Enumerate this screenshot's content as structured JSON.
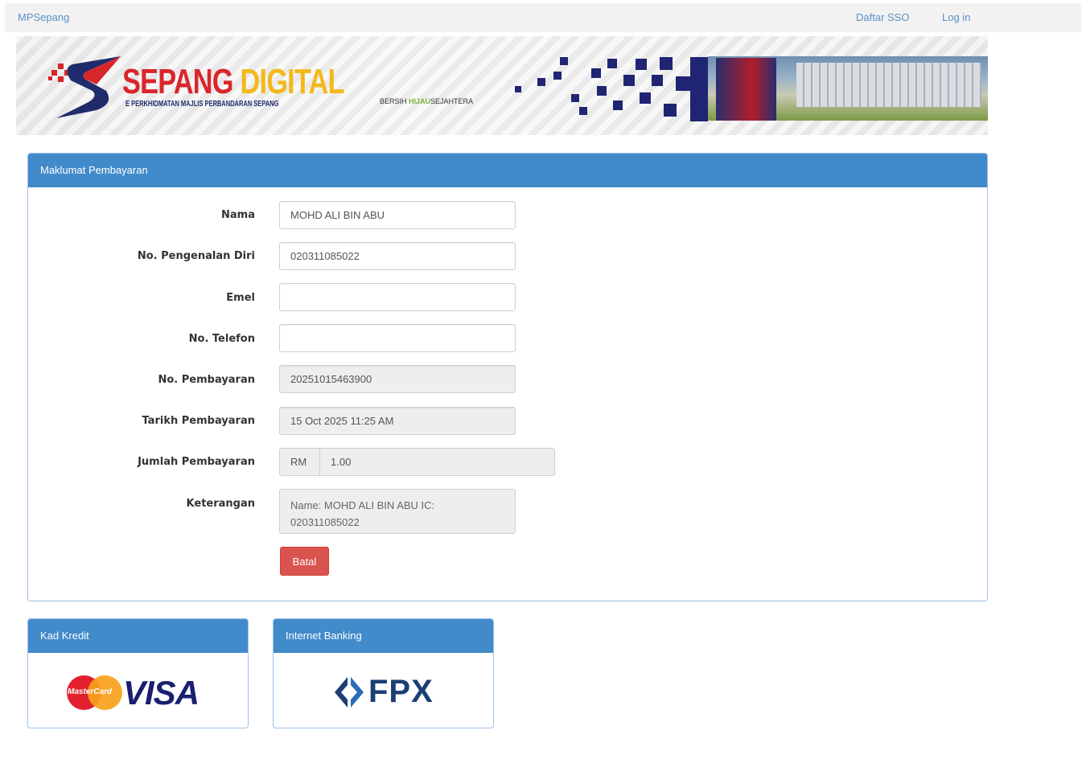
{
  "topbar": {
    "brand": "MPSepang",
    "register": "Daftar SSO",
    "login": "Log in"
  },
  "banner": {
    "title_part1": "SEPANG",
    "title_part2": "DIGITAL",
    "subtitle": "E PERKHIDMATAN MAJLIS PERBANDARAN SEPANG",
    "motto_part1": "BERSIH",
    "motto_part2": "HIJAU",
    "motto_part3": "SEJAHTERA"
  },
  "payment_panel": {
    "heading": "Maklumat Pembayaran",
    "fields": {
      "nama_label": "Nama",
      "nama_value": "MOHD ALI BIN ABU",
      "ic_label": "No. Pengenalan Diri",
      "ic_value": "020311085022",
      "emel_label": "Emel",
      "emel_value": "",
      "telefon_label": "No. Telefon",
      "telefon_value": "",
      "no_pembayaran_label": "No. Pembayaran",
      "no_pembayaran_value": "20251015463900",
      "tarikh_label": "Tarikh Pembayaran",
      "tarikh_value": "15 Oct 2025 11:25 AM",
      "jumlah_label": "Jumlah Pembayaran",
      "jumlah_currency": "RM",
      "jumlah_value": "1.00",
      "keterangan_label": "Keterangan",
      "keterangan_value": "Name: MOHD ALI BIN ABU IC: 020311085022"
    },
    "cancel_button": "Batal"
  },
  "payment_methods": {
    "card": {
      "heading": "Kad Kredit",
      "mc_label": "MasterCard",
      "visa_label": "VISA"
    },
    "fpx": {
      "heading": "Internet Banking",
      "fpx_label": "FPX"
    }
  },
  "colors": {
    "primary": "#428bca",
    "danger": "#d9534f",
    "link": "#5b8fc8"
  }
}
